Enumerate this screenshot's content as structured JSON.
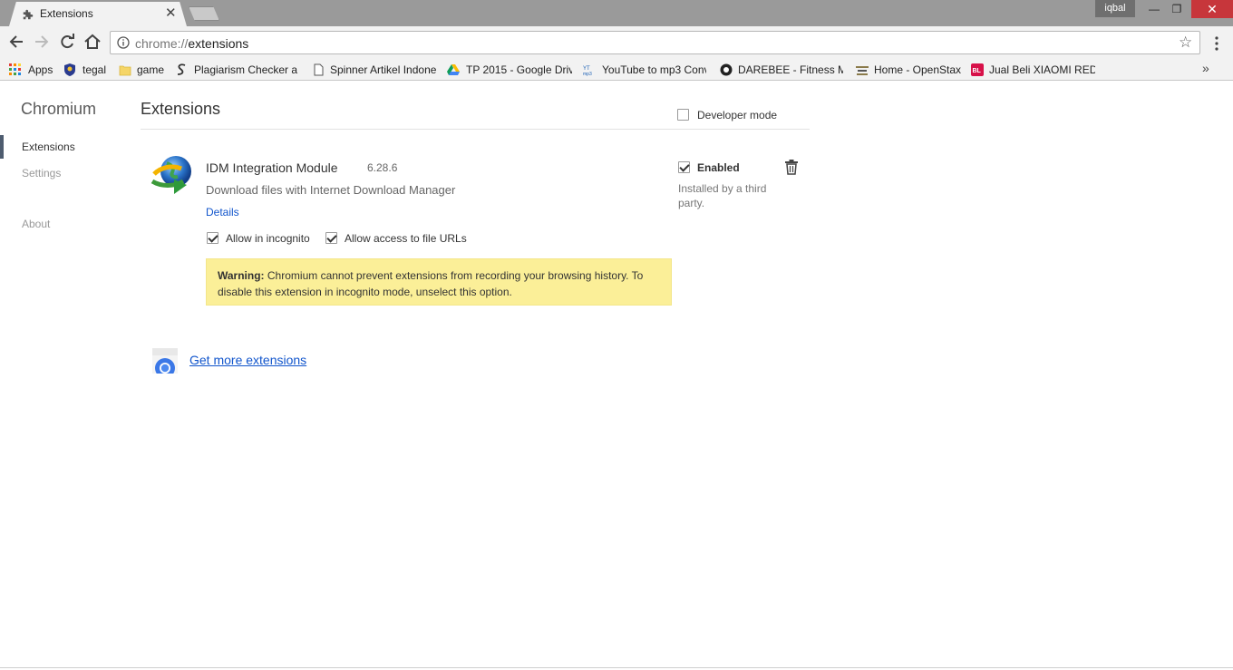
{
  "window": {
    "tab_title": "Extensions",
    "tab_close": "✕",
    "profile_name": "iqbal",
    "minimize": "—",
    "restore": "❐",
    "close": "✕"
  },
  "toolbar": {
    "url_scheme": "chrome://",
    "url_path": "extensions",
    "star": "☆"
  },
  "bookmarks": {
    "items": [
      {
        "label": "Apps",
        "icon": "apps-grid-icon"
      },
      {
        "label": "tegal",
        "icon": "shield-badge-icon"
      },
      {
        "label": "game",
        "icon": "folder-icon"
      },
      {
        "label": "Plagiarism Checker a",
        "icon": "s-logo-icon"
      },
      {
        "label": "Spinner Artikel Indone",
        "icon": "page-icon"
      },
      {
        "label": "TP 2015 - Google Driv",
        "icon": "google-drive-icon"
      },
      {
        "label": "YouTube to mp3 Conv",
        "icon": "youtube-mp3-icon"
      },
      {
        "label": "DAREBEE - Fitness Ma",
        "icon": "darebee-icon"
      },
      {
        "label": "Home - OpenStax",
        "icon": "openstax-icon"
      },
      {
        "label": "Jual Beli XIAOMI REDI",
        "icon": "bukalapak-icon"
      }
    ],
    "more": "»"
  },
  "sidebar": {
    "brand": "Chromium",
    "items": [
      {
        "label": "Extensions"
      },
      {
        "label": "Settings"
      },
      {
        "label": "About"
      }
    ]
  },
  "main": {
    "title": "Extensions",
    "developer_mode_label": "Developer mode",
    "developer_mode_checked": false,
    "extension": {
      "name": "IDM Integration Module",
      "version": "6.28.6",
      "description": "Download files with Internet Download Manager",
      "details_link": "Details",
      "allow_incognito_label": "Allow in incognito",
      "allow_incognito_checked": true,
      "allow_file_urls_label": "Allow access to file URLs",
      "allow_file_urls_checked": true,
      "warning_title": "Warning:",
      "warning_text": "Chromium cannot prevent extensions from recording your browsing history. To disable this extension in incognito mode, unselect this option.",
      "enabled_label": "Enabled",
      "enabled_checked": true,
      "installed_note": "Installed by a third party."
    },
    "get_more_link": "Get more extensions"
  },
  "colors": {
    "link": "#1155cc",
    "warning_bg": "#fbef98",
    "close_red": "#c7363b"
  }
}
